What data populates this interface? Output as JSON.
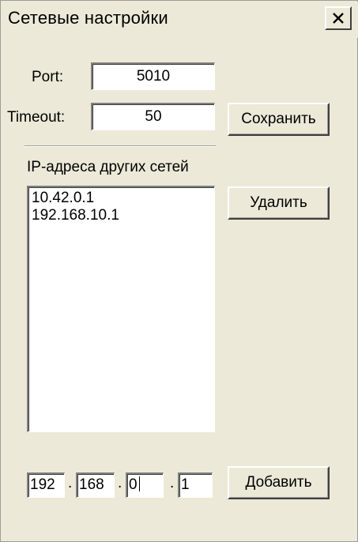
{
  "window": {
    "title": "Сетевые настройки",
    "close_symbol": "✕"
  },
  "settings": {
    "port_label": "Port:",
    "port_value": "5010",
    "timeout_label": "Timeout:",
    "timeout_value": "50",
    "save_button": "Сохранить"
  },
  "networks": {
    "group_label": "IP-адреса других сетей",
    "items": [
      "10.42.0.1",
      "192.168.10.1"
    ],
    "delete_button": "Удалить"
  },
  "ip_entry": {
    "octets": [
      "192",
      "168",
      "0",
      "1"
    ],
    "separator": ".",
    "add_button": "Добавить"
  },
  "colors": {
    "window_bg": "#ece9d8",
    "field_bg": "#ffffff"
  }
}
